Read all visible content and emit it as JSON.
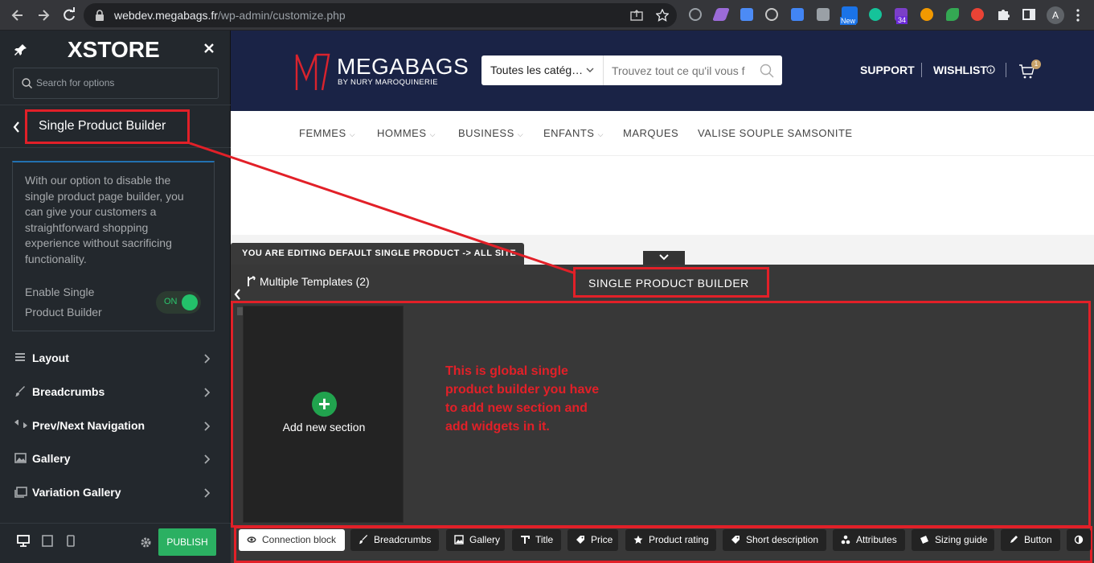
{
  "browser": {
    "url_host": "webdev.megabags.fr",
    "url_path": "/wp-admin/customize.php",
    "ext_badge_new": "New",
    "ext_badge_count": "34",
    "profile_initial": "A"
  },
  "sidebar": {
    "logo": "XSTORE",
    "search_placeholder": "Search for options",
    "section_title": "Single Product Builder",
    "info_text": "With our option to disable the single product page builder, you can give your customers a straightforward shopping experience without sacrificing functionality.",
    "enable_label": "Enable Single Product Builder",
    "toggle_state": "ON",
    "menu": [
      {
        "label": "Layout",
        "icon": "layout-icon"
      },
      {
        "label": "Breadcrumbs",
        "icon": "brush-icon"
      },
      {
        "label": "Prev/Next Navigation",
        "icon": "arrows-icon"
      },
      {
        "label": "Gallery",
        "icon": "image-icon"
      },
      {
        "label": "Variation Gallery",
        "icon": "images-icon"
      }
    ],
    "publish_label": "PUBLISH"
  },
  "site": {
    "brand": "MEGABAGS",
    "brand_sub": "BY NURY MAROQUINERIE",
    "category_select": "Toutes les catég…",
    "search_placeholder": "Trouvez tout ce qu'il vous f",
    "support": "SUPPORT",
    "wishlist": "WISHLIST",
    "cart_count": "1",
    "nav": [
      "FEMMES",
      "HOMMES",
      "BUSINESS",
      "ENFANTS",
      "MARQUES",
      "VALISE SOUPLE SAMSONITE"
    ]
  },
  "builder": {
    "editing_notice": "YOU ARE EDITING DEFAULT SINGLE PRODUCT -> ALL SITE",
    "multiple_templates": "Multiple Templates (2)",
    "label": "SINGLE PRODUCT BUILDER",
    "add_section": "Add new section",
    "annotation": "This is global single product builder you have to add new section and  add widgets in it.",
    "widgets": [
      {
        "label": "Connection block",
        "icon": "connection-icon"
      },
      {
        "label": "Breadcrumbs",
        "icon": "brush-icon"
      },
      {
        "label": "Gallery",
        "icon": "image-icon"
      },
      {
        "label": "Title",
        "icon": "title-icon"
      },
      {
        "label": "Price",
        "icon": "tag-icon"
      },
      {
        "label": "Product rating",
        "icon": "star-icon"
      },
      {
        "label": "Short description",
        "icon": "tag-icon"
      },
      {
        "label": "Attributes",
        "icon": "attributes-icon"
      },
      {
        "label": "Sizing guide",
        "icon": "ruler-icon"
      },
      {
        "label": "Button",
        "icon": "pencil-icon"
      }
    ]
  },
  "colors": {
    "highlight": "#e22028",
    "publish": "#2bb062",
    "header_navy": "#1a2346"
  }
}
